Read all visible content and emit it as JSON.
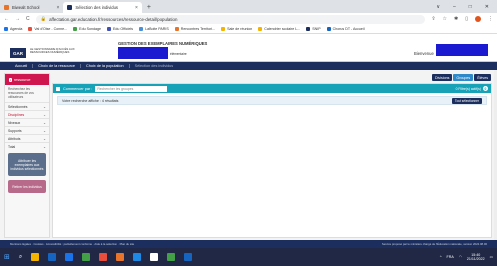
{
  "browser": {
    "tabs": [
      {
        "title": "Biwealt School",
        "color": "#e8732b"
      },
      {
        "title": "Sélection des individus",
        "color": "#1b2e5e"
      }
    ],
    "new_tab": "+",
    "window_controls": [
      "∨",
      "–",
      "□",
      "✕"
    ],
    "url": "affectation.gar.education.fr/ressources/ressource-detail/population",
    "nav_icons": [
      "←",
      "→",
      "C"
    ],
    "bookmarks": [
      {
        "label": "Agenda",
        "color": "#1a73e8"
      },
      {
        "label": "Val d'Oise - Conne...",
        "color": "#e94e3c"
      },
      {
        "label": "Edu Sondage",
        "color": "#43a047"
      },
      {
        "label": "Edu Officiels",
        "color": "#3f51b5"
      },
      {
        "label": "LaBoite PARIS",
        "color": "#4a90d9"
      },
      {
        "label": "Rencontres Territori...",
        "color": "#e8732b"
      },
      {
        "label": "Sale de réunion",
        "color": "#f4b400"
      },
      {
        "label": "Calendrier scolaire L...",
        "color": "#f4b400"
      },
      {
        "label": "SNIP",
        "color": "#1b2e5e"
      },
      {
        "label": "Chorus DT - Accueil",
        "color": "#1565c0"
      }
    ]
  },
  "gar": {
    "logo": "GAR",
    "logo_text": "LE GESTIONNAIRE D'ACCÈS AUX RESSOURCES NUMÉRIQUES",
    "app_title": "GESTION DES EXEMPLAIRES NUMÉRIQUES",
    "establishment_suffix": "élémentaire",
    "welcome": "Bienvenue",
    "nav": [
      "Accueil",
      "Choix de la ressource",
      "Choix de la population",
      "Sélection des individus"
    ]
  },
  "left": {
    "rubric": "ressource",
    "rubric_badge": "i",
    "intro": "Recherchez les ressources de vos utilisateurs",
    "filters": [
      {
        "label": "Sélectionnés",
        "red": false
      },
      {
        "label": "Disciplines",
        "red": true
      },
      {
        "label": "Niveaux",
        "red": false
      },
      {
        "label": "Supports",
        "red": false
      },
      {
        "label": "Attributs",
        "red": false
      },
      {
        "label": "Total",
        "red": false
      }
    ],
    "assign_button": "Attribuer les exemplaires aux individus sélectionnés",
    "remove_button": "Retirer les individus"
  },
  "main": {
    "view_buttons": [
      "Divisions",
      "Groupes",
      "Élèves"
    ],
    "active_view": 1,
    "search_label": "Commencer par :",
    "search_placeholder": "Rechercher les groupes",
    "filters_active": "0 Filtre(s) actif(s)",
    "filters_count": "0",
    "result_text": "Votre recherche affiche : 4 résultats",
    "select_all": "Tout sélectionner"
  },
  "footer": {
    "left": "Mentions légales · Cookies · Accessibilité : partiellement conforme · Aide à la sélection · Plan du site",
    "right": "Service proposé par le ministère chargé de l'Éducation nationale, version 2022.08.00"
  },
  "taskbar": {
    "apps": [
      "#f4b400",
      "#1565c0",
      "#1a73e8",
      "#43a047",
      "#e94e3c",
      "#e8732b",
      "#1e88e5",
      "#ffffff",
      "#43a047",
      "#1565c0"
    ],
    "lang": "FRA",
    "time": "15:40",
    "date": "21/11/2022"
  }
}
